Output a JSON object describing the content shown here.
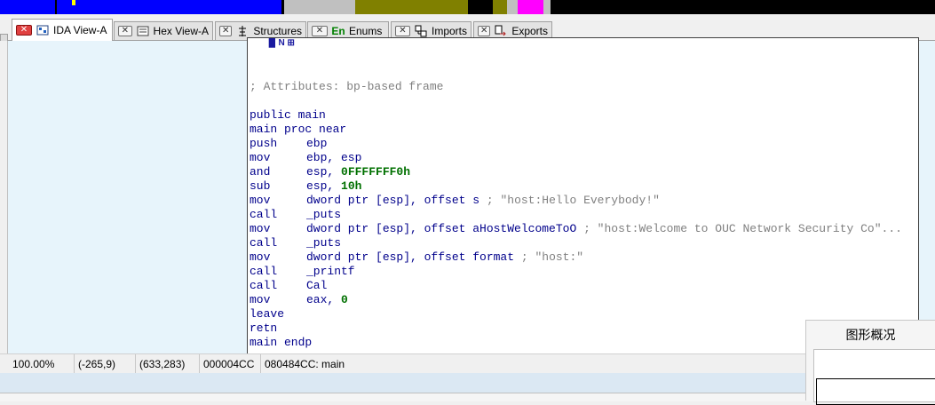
{
  "nav_band": {
    "segments": [
      {
        "color": "#0000ff"
      },
      {
        "color": "#000000"
      },
      {
        "color": "#0000ff"
      },
      {
        "color": "#c0c0c0"
      },
      {
        "color": "#808000"
      },
      {
        "color": "#000000"
      },
      {
        "color": "#808000"
      },
      {
        "color": "#c0c0c0"
      },
      {
        "color": "#ff00ff"
      },
      {
        "color": "#c0c0c0"
      },
      {
        "color": "#000000"
      }
    ],
    "marker_color": "#ffff00"
  },
  "tabs": [
    {
      "label": "IDA View-A",
      "icon": "ida-view-icon",
      "active": true
    },
    {
      "label": "Hex View-A",
      "icon": "hex-view-icon",
      "active": false
    },
    {
      "label": "Structures",
      "icon": "structures-icon",
      "active": false
    },
    {
      "label": "Enums",
      "icon": "enums-icon",
      "icon_text": "En",
      "active": false
    },
    {
      "label": "Imports",
      "icon": "imports-icon",
      "active": false
    },
    {
      "label": "Exports",
      "icon": "exports-icon",
      "active": false
    }
  ],
  "code": {
    "comment_attributes": "; Attributes: bp-based frame",
    "public_line": "public main",
    "proc_line": "main proc near",
    "instructions": [
      {
        "mnemonic": "push",
        "operands": "ebp",
        "comment": ""
      },
      {
        "mnemonic": "mov",
        "operands": "ebp, esp",
        "comment": ""
      },
      {
        "mnemonic": "and",
        "operands_prefix": "esp, ",
        "operands_number": "0FFFFFFF0h",
        "comment": ""
      },
      {
        "mnemonic": "sub",
        "operands_prefix": "esp, ",
        "operands_number": "10h",
        "comment": ""
      },
      {
        "mnemonic": "mov",
        "operands": "dword ptr [esp], offset s",
        "comment": "; \"host:Hello Everybody!\""
      },
      {
        "mnemonic": "call",
        "operands": "_puts",
        "comment": ""
      },
      {
        "mnemonic": "mov",
        "operands": "dword ptr [esp], offset aHostWelcomeToO",
        "comment": "; \"host:Welcome to OUC Network Security Co\"..."
      },
      {
        "mnemonic": "call",
        "operands": "_puts",
        "comment": ""
      },
      {
        "mnemonic": "mov",
        "operands": "dword ptr [esp], offset format",
        "comment": "; \"host:\""
      },
      {
        "mnemonic": "call",
        "operands": "_printf",
        "comment": ""
      },
      {
        "mnemonic": "call",
        "operands": "Cal",
        "comment": ""
      },
      {
        "mnemonic": "mov",
        "operands_prefix": "eax, ",
        "operands_number": "0",
        "comment": ""
      },
      {
        "mnemonic": "leave",
        "operands": "",
        "comment": ""
      },
      {
        "mnemonic": "retn",
        "operands": "",
        "comment": ""
      }
    ],
    "endp_line": "main endp"
  },
  "status_bar": {
    "zoom": "100.00%",
    "coords1": "(-265,9)",
    "coords2": "(633,283)",
    "offset": "000004CC",
    "location": "080484CC: main"
  },
  "overview": {
    "title": "图形概况"
  },
  "colors": {
    "graph_background": "#e7f4fb",
    "keyword": "#00008b",
    "number": "#007000",
    "comment": "#808080"
  }
}
